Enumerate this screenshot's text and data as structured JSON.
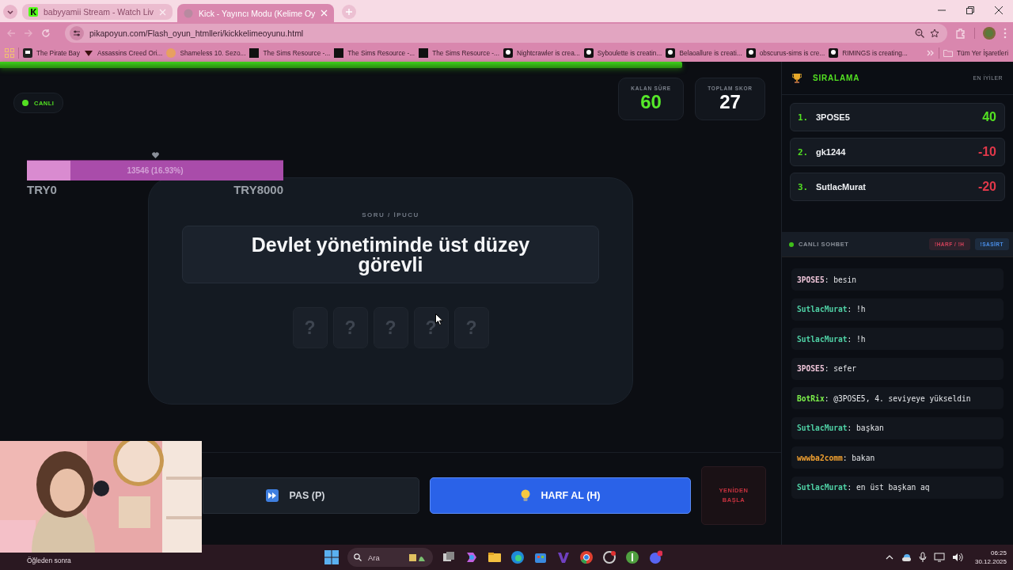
{
  "browser": {
    "tabs": [
      {
        "title": "babyyamii Stream - Watch Liv",
        "selected": false
      },
      {
        "title": "Kick - Yayıncı Modu (Kelime Oy",
        "selected": true
      }
    ],
    "url": "pikapoyun.com/Flash_oyun_htmlleri/kickkelimeoyunu.html",
    "bookmarks": [
      "The Pirate Bay",
      "Assassins Creed Ori...",
      "Shameless 10. Sezo...",
      "The Sims Resource -...",
      "The Sims Resource -...",
      "The Sims Resource -...",
      "Nightcrawler is crea...",
      "Syboulette is creatin...",
      "Belaoallure is creati...",
      "obscurus-sims is cre...",
      "RIMINGS is creating..."
    ],
    "all_bookmarks": "Tüm Yer İşaretleri"
  },
  "game": {
    "timer": {
      "level": 0.873
    },
    "live_badge": "CANLI",
    "stats": [
      {
        "kind": "time",
        "label": "KALAN SÜRE",
        "value": "60"
      },
      {
        "kind": "score",
        "label": "TOPLAM SKOR",
        "value": "27"
      }
    ],
    "goal": {
      "text": "13546 (16.93%)",
      "level": 0.1693,
      "min": "TRY0",
      "max": "TRY8000"
    },
    "question": {
      "label": "SORU / İPUCU",
      "text": "Devlet yönetiminde üst düzey görevli",
      "tiles": [
        "?",
        "?",
        "?",
        "?",
        "?"
      ]
    },
    "buttons": [
      {
        "kind": "pass",
        "label": "PAS (P)"
      },
      {
        "kind": "hint",
        "label": "HARF AL (H)"
      },
      {
        "kind": "restart",
        "label": "YENİDEN BAŞLA"
      }
    ]
  },
  "leaderboard": {
    "title": "SIRALAMA",
    "subtitle": "EN İYİLER",
    "entries": [
      {
        "rank": "1.",
        "name": "3POSE5",
        "score": "40",
        "positive": true
      },
      {
        "rank": "2.",
        "name": "gk1244",
        "score": "-10",
        "positive": false
      },
      {
        "rank": "3.",
        "name": "SutlacMurat",
        "score": "-20",
        "positive": false
      }
    ]
  },
  "chat": {
    "title": "CANLI SOHBET",
    "commands": [
      {
        "label": "!HARF / !H",
        "color": "#d0415a"
      },
      {
        "label": "!SASİRT",
        "color": "#4a8ee8"
      }
    ],
    "messages": [
      {
        "user": "3POSE5",
        "text": ": besin",
        "color": "#f2c8dc"
      },
      {
        "user": "SutlacMurat",
        "text": ": !h",
        "color": "#4fd1a5"
      },
      {
        "user": "SutlacMurat",
        "text": ": !h",
        "color": "#4fd1a5"
      },
      {
        "user": "3POSE5",
        "text": ": sefer",
        "color": "#f2c8dc"
      },
      {
        "user": "BotRix",
        "text": ": @3POSE5, 4. seviyeye yükseldin",
        "color": "#7cf04a"
      },
      {
        "user": "SutlacMurat",
        "text": ": başkan",
        "color": "#4fd1a5"
      },
      {
        "user": "wwwba2comm",
        "text": ": bakan",
        "color": "#f0a030"
      },
      {
        "user": "SutlacMurat",
        "text": ": en üst başkan aq",
        "color": "#4fd1a5"
      }
    ]
  },
  "taskbar": {
    "weather": "Öğleden sonra",
    "search": "Ara",
    "time": "06:25",
    "date": "30.12.2025"
  }
}
